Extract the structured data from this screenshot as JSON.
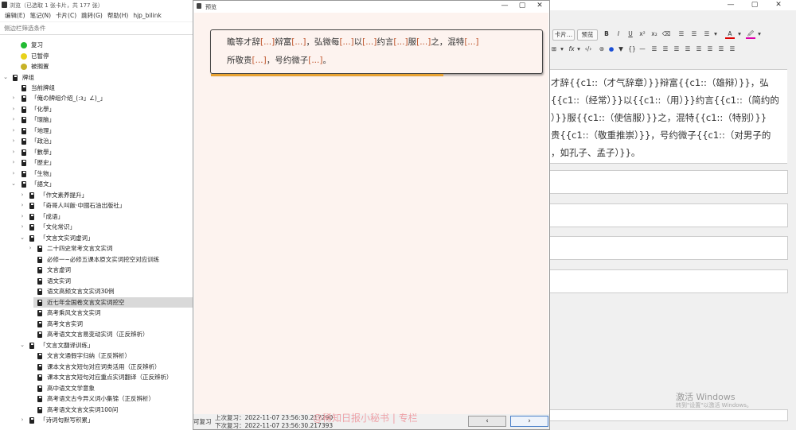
{
  "main_window": {
    "title": "浏览（已选取 1 张卡片，共 177 张）",
    "controls": [
      "—",
      "▢",
      "✕"
    ]
  },
  "menu": [
    "编辑(E)",
    "笔记(N)",
    "卡片(C)",
    "跳转(G)",
    "帮助(H)",
    "hjp_bilink"
  ],
  "filter": {
    "placeholder": "侧边栏筛选条件"
  },
  "sidebar": {
    "status_items": [
      {
        "label": "复习",
        "color": "#22bb33"
      },
      {
        "label": "已暂停",
        "color": "#e8d21a"
      },
      {
        "label": "被搁置",
        "color": "#c7b227"
      }
    ],
    "deck_root": "牌组",
    "current_deck": "当前牌组",
    "decks_level1": [
      "「俺の牌组介绍_(:з」∠)_」",
      "「化學」",
      "「環脑」",
      "「地理」",
      "「政治」",
      "「數學」",
      "「歷史」",
      "「生物」"
    ],
    "chinese": "「語文」",
    "chinese_children": [
      "「作文素养提升」",
      "「奇哥人叫飯·中國石油出版社」",
      "「成语」",
      "「文化常识」"
    ],
    "wenyan": "「文言文实词虚词」",
    "wenyan_children": [
      "二十四史常考文言文实词",
      "必修一~必修五课本原文实词挖空对应训练",
      "文言虚词",
      "语文实词",
      "语文高频文言文实词30例",
      "近七年全国卷文言文实词挖空",
      "高考乘风文言文实词",
      "高考文言实词",
      "高考语文文言易变动实词（正反辨析）"
    ],
    "fanyi": "「文言文翻译训练」",
    "fanyi_children": [
      "文言文通假字归纳（正反辨析）",
      "课本文言文短句对应词类活用（正反辨析）",
      "课本文言文短句对应重点实词翻译（正反辨析）",
      "高中语文文学意象",
      "高考语文古今异义词小集锦（正反辨析）",
      "高考语文文言文实词100问"
    ],
    "last_item": "「诗词句默写积累」",
    "selected_index": 5
  },
  "editor": {
    "toolbar_row1": [
      "卡片...",
      "预览",
      "B",
      "I",
      "U",
      "x²",
      "x₂",
      "⌫",
      "☰",
      "☰",
      "☰",
      "▾",
      "A",
      "▾",
      "🖉",
      "▾"
    ],
    "toolbar_row2": [
      "⊞",
      "▾",
      "fx",
      "▾",
      "‹/›",
      "⊛",
      "●",
      "▼",
      "{}",
      "—",
      "☰",
      "☰",
      "☰",
      "☰",
      "☰",
      "☰",
      "☰",
      "☰"
    ],
    "field_lines": [
      "才辞{{c1::（才气辞章）}}辩富{{c1::（雄辩）}}，弘",
      "{{c1::（经常）}}以{{c1::（用）}}约言{{c1::（简约的",
      "）}}服{{c1::（使信服）}}之，混特{{c1::（特别）}}",
      "贵{{c1::（敬重推崇）}}，号约微子{{c1::（对男子的",
      "，如孔子、孟子）}}。"
    ],
    "activate_title": "激活 Windows",
    "activate_hint": "转到\"设置\"以激活 Windows。"
  },
  "preview": {
    "title": "预览",
    "controls": [
      "—",
      "▢",
      "✕"
    ],
    "card_line1": [
      {
        "t": "瞻等才辞",
        "c": false
      },
      {
        "t": "[...]",
        "c": true
      },
      {
        "t": "辩富",
        "c": false
      },
      {
        "t": "[...]",
        "c": true
      },
      {
        "t": "，弘微每",
        "c": false
      },
      {
        "t": "[...]",
        "c": true
      },
      {
        "t": "以",
        "c": false
      },
      {
        "t": "[...]",
        "c": true
      },
      {
        "t": "约言",
        "c": false
      },
      {
        "t": "[...]",
        "c": true
      },
      {
        "t": "服",
        "c": false
      },
      {
        "t": "[...]",
        "c": true
      },
      {
        "t": "之，混特",
        "c": false
      },
      {
        "t": "[...]",
        "c": true
      }
    ],
    "card_line2": [
      {
        "t": "所敬贵",
        "c": false
      },
      {
        "t": "[...]",
        "c": true
      },
      {
        "t": "，号约微子",
        "c": false
      },
      {
        "t": "[...]",
        "c": true
      },
      {
        "t": "。",
        "c": false
      }
    ],
    "bottom_left": "可复习",
    "last_review": "上次复习：2022-11-07 23:56:30.217290",
    "next_review": "下次复习：2022-11-07 23:56:30.217393",
    "watermark": "@稀知日报小秘书 | 专栏",
    "prev_label": "‹",
    "next_label": "›"
  },
  "colors": {
    "cloze": "#c0572e",
    "preview_bg": "#fdf3ef",
    "underline": "#e8a232"
  }
}
